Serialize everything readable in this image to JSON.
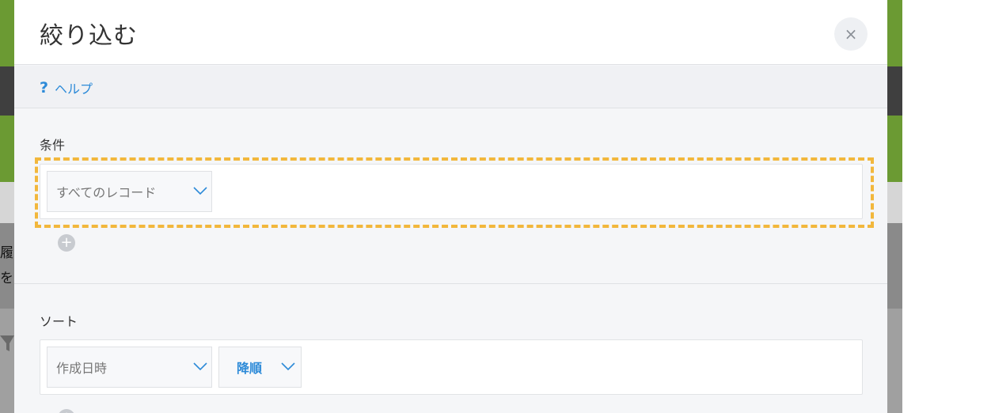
{
  "background": {
    "char_1": "履",
    "char_2": "を"
  },
  "dialog": {
    "title": "絞り込む",
    "close_label": "×",
    "help": {
      "icon": "?",
      "label": "ヘルプ"
    },
    "condition": {
      "label": "条件",
      "selected": "すべてのレコード",
      "add_label": "+"
    },
    "sort": {
      "label": "ソート",
      "field": "作成日時",
      "order": "降順",
      "add_label": "+"
    }
  },
  "colors": {
    "accent": "#2c8ad8",
    "highlight": "#f2b73c",
    "header_green": "#6b9a33"
  },
  "icons": {
    "close": "close-icon",
    "help": "help-icon",
    "chevron": "chevron-down-icon",
    "add": "plus-circle-icon"
  }
}
